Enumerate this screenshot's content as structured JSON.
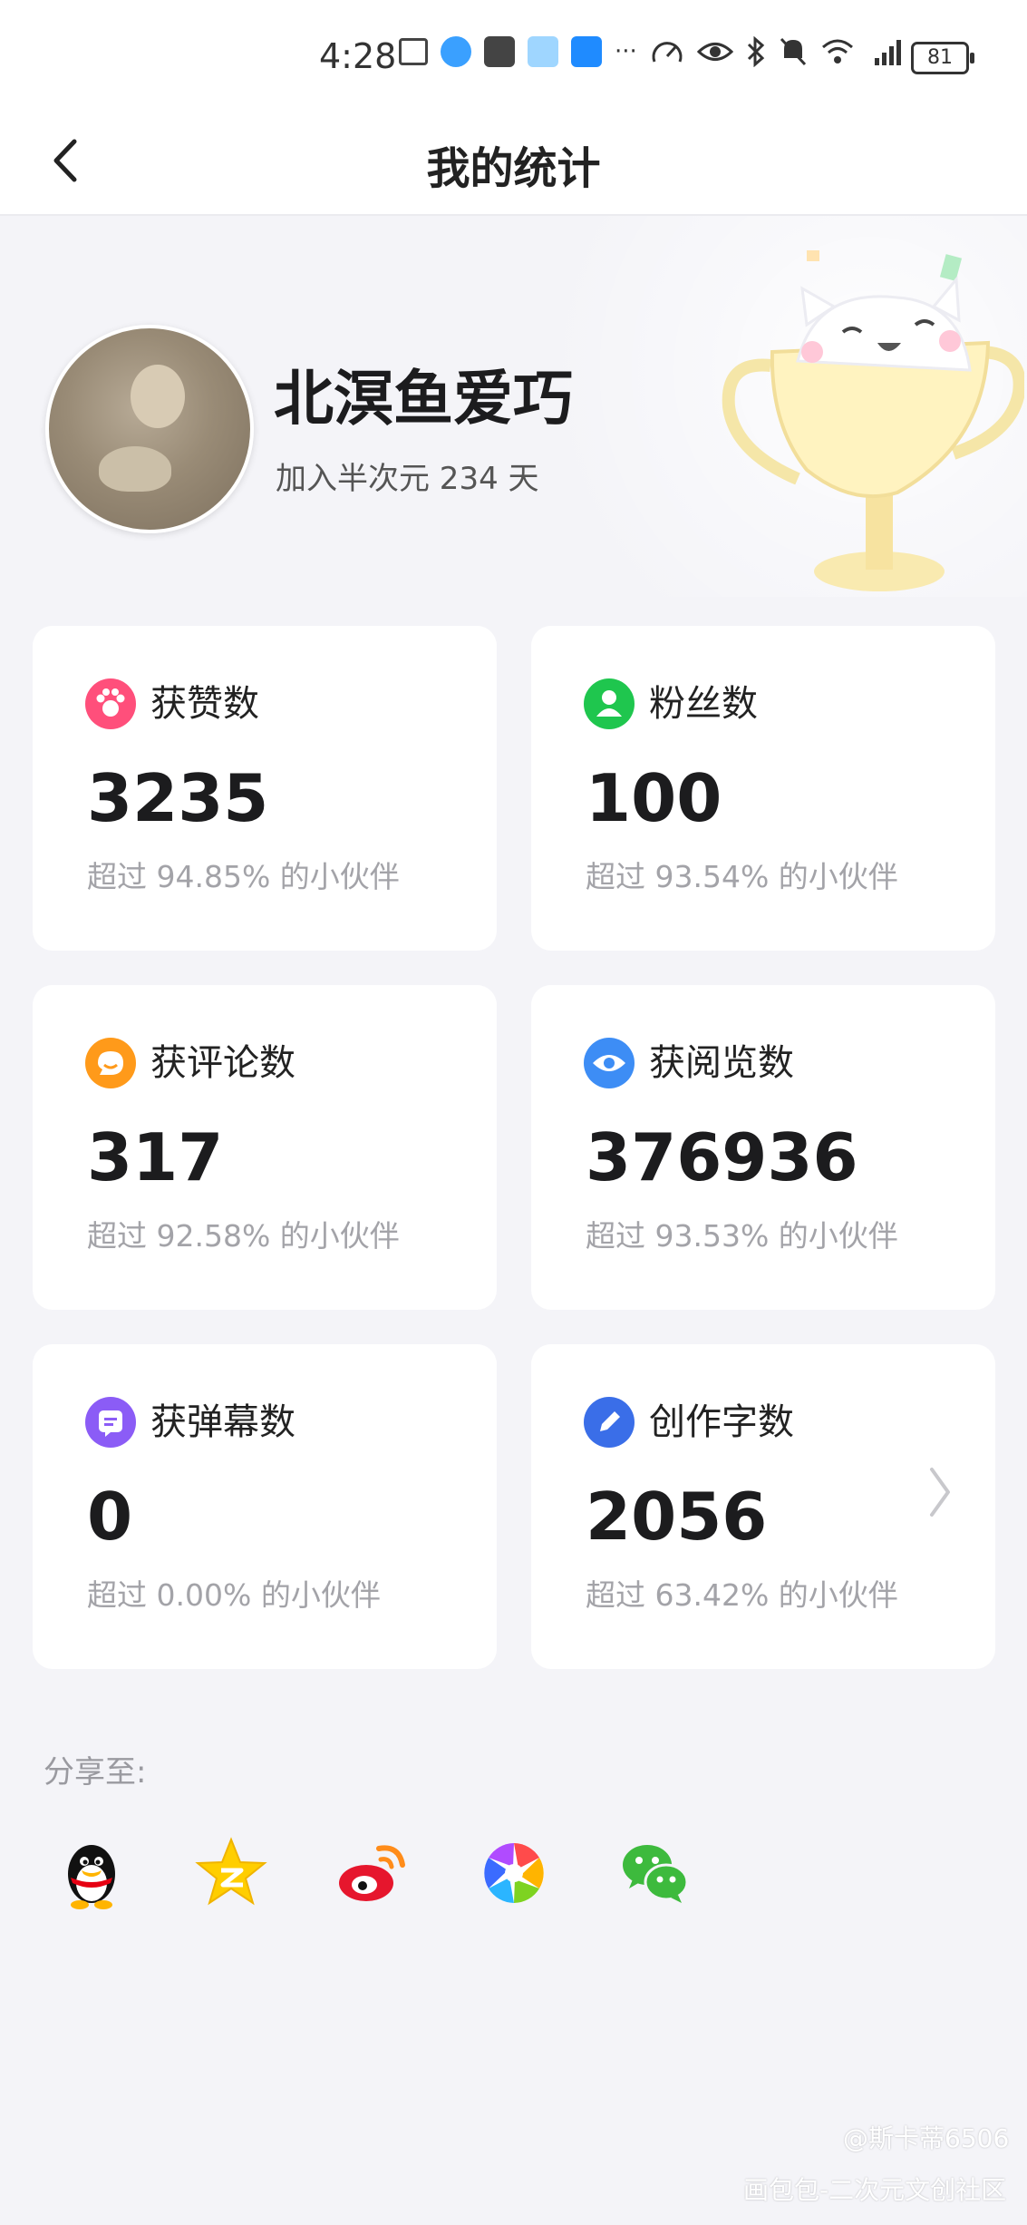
{
  "status_bar": {
    "time": "4:28",
    "overflow": "···",
    "battery": "81",
    "icons": [
      "files-icon",
      "browser-icon",
      "mail-icon",
      "bunny-app-icon",
      "weather-icon",
      "speed-icon",
      "eye-icon",
      "bluetooth-icon",
      "mute-bell-icon",
      "wifi-icon",
      "signal-4g-icon"
    ]
  },
  "nav": {
    "title": "我的统计",
    "back_icon": "chevron-left-icon"
  },
  "profile": {
    "username": "北溟鱼爱巧",
    "join_text": "加入半次元 234 天"
  },
  "stats": [
    {
      "label": "获赞数",
      "value": "3235",
      "sub": "超过 94.85% 的小伙伴",
      "icon": "paw-icon",
      "color": "#ff4f7b"
    },
    {
      "label": "粉丝数",
      "value": "100",
      "sub": "超过 93.54% 的小伙伴",
      "icon": "person-icon",
      "color": "#1fc64e"
    },
    {
      "label": "获评论数",
      "value": "317",
      "sub": "超过 92.58% 的小伙伴",
      "icon": "comment-icon",
      "color": "#ff9a1a"
    },
    {
      "label": "获阅览数",
      "value": "376936",
      "sub": "超过 93.53% 的小伙伴",
      "icon": "eye-icon",
      "color": "#3d8df5"
    },
    {
      "label": "获弹幕数",
      "value": "0",
      "sub": "超过 0.00% 的小伙伴",
      "icon": "danmaku-icon",
      "color": "#8b5cf6"
    },
    {
      "label": "创作字数",
      "value": "2056",
      "sub": "超过 63.42% 的小伙伴",
      "icon": "pen-icon",
      "color": "#3a6ee8"
    }
  ],
  "share": {
    "label": "分享至:",
    "targets": [
      "qq-icon",
      "qzone-icon",
      "weibo-icon",
      "camera-app-icon",
      "wechat-icon"
    ]
  },
  "watermark": {
    "line1": "@斯卡蒂6506",
    "line2": "画包包-二次元文创社区"
  }
}
